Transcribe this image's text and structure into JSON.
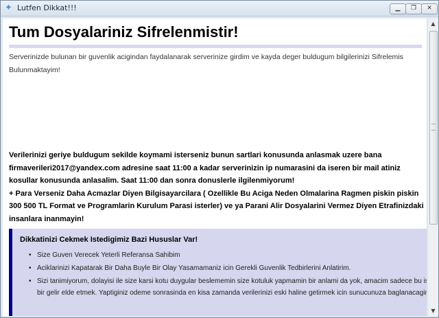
{
  "window": {
    "title": "Lutfen Dikkat!!!",
    "controls": {
      "minimize": "▁",
      "maximize": "❐",
      "close": "✕"
    }
  },
  "content": {
    "heading": "Tum Dosyalariniz Sifrelenmistir!",
    "intro": "Serverinizde bulunan bir guvenlik acigindan faydalanarak serverinize girdim ve kayda deger buldugum bilgilerinizi Sifrelemis Bulunmaktayim!",
    "notice_paragraph_1": "Verilerinizi geriye buldugum sekilde koymami isterseniz bunun sartlari konusunda anlasmak uzere bana firmaverileri2017@yandex.com adresine saat 11:00 a kadar serverinizin ip numarasini da iseren bir mail atiniz kosullar konusunda anlasalim. Saat 11:00 dan sonra donuslerle ilgilenmiyorum!",
    "notice_paragraph_2": "+ Para Verseniz Daha Acmazlar Diyen Bilgisayarcilara ( Ozellikle Bu Aciga Neden Olmalarina Ragmen piskin piskin 300 500 TL Format ve Programlarin Kurulum Parasi isterler) ve ya Parani Alir Dosyalarini Vermez Diyen Etrafinizdaki insanlara inanmayin!",
    "points_title": "Dikkatinizi Cekmek Istedigimiz Bazi Hususlar Var!",
    "points": [
      "Size Guven Verecek Yeterli Referansa Sahibim",
      "Aciklarinizi Kapatarak Bir Daha Buyle Bir Olay Yasamamaniz icin Gerekli Guvenlik Tedbirlerini Anlatirim.",
      "Sizi tanimiyorum, dolayisi ile size karsi kotu duygular beslememin size kotuluk yapmamin bir anlami da yok, amacim sadece bu isten bir gelir elde etmek. Yaptiginiz odeme sonrasinda en kisa zamanda verilerinizi eski haline getirmek icin sunucunuza baglanacagim."
    ]
  },
  "colors": {
    "accent_bar": "#00008b",
    "box_background": "#d6d6ee",
    "rule": "#d8d8ee"
  },
  "icons": {
    "app": "window-app-icon",
    "scroll_up": "▲",
    "scroll_down": "▼"
  }
}
